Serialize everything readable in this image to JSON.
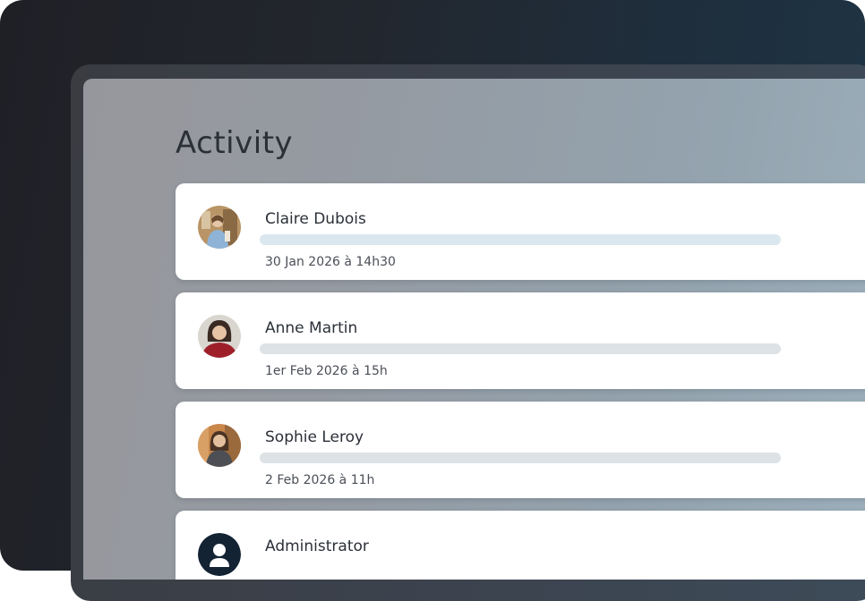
{
  "page": {
    "title": "Activity"
  },
  "activities": [
    {
      "name": "Claire Dubois",
      "timestamp": "30 Jan 2026 à 14h30",
      "avatar_icon": "user-photo-icon",
      "bar_color": "#dbe7ef"
    },
    {
      "name": "Anne Martin",
      "timestamp": "1er Feb 2026 à 15h",
      "avatar_icon": "user-photo-icon",
      "bar_color": "#dde2e6"
    },
    {
      "name": "Sophie Leroy",
      "timestamp": "2 Feb 2026 à 11h",
      "avatar_icon": "user-photo-icon",
      "bar_color": "#dde2e6"
    },
    {
      "name": "Administrator",
      "timestamp": "",
      "avatar_icon": "user-silhouette-icon",
      "bar_color": "#dde2e6"
    }
  ]
}
